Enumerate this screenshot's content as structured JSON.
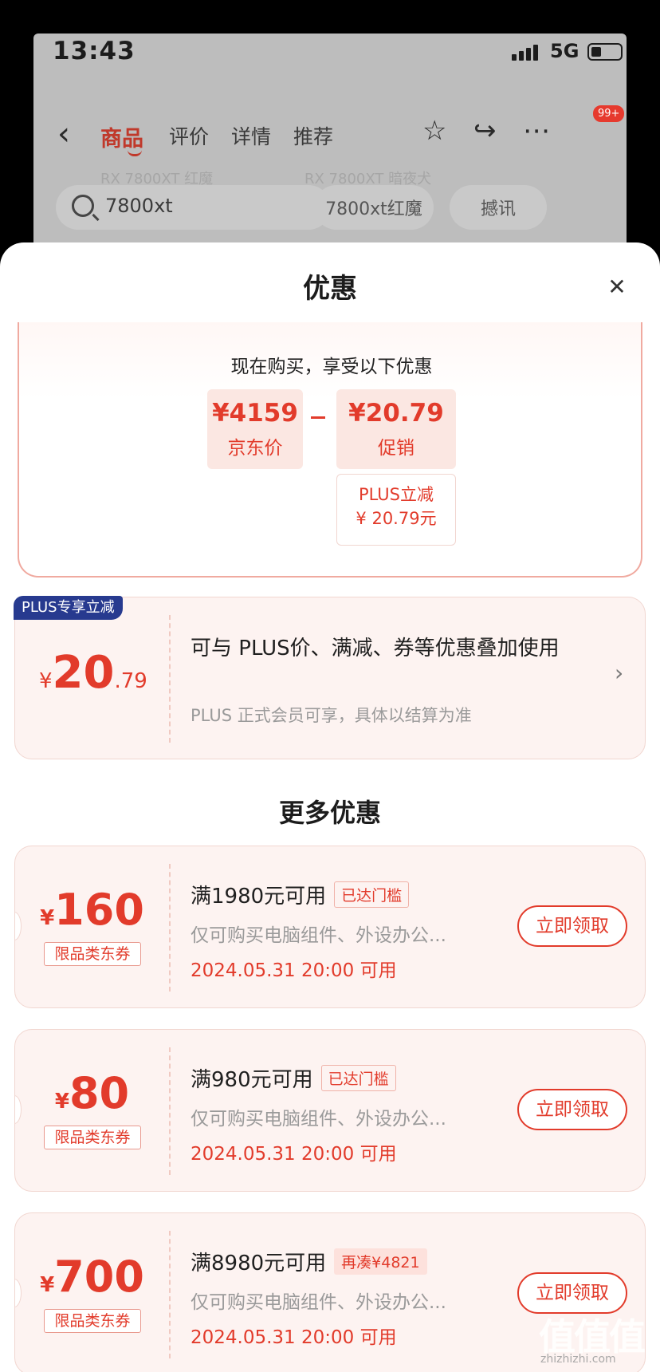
{
  "status_bar": {
    "time": "13:43",
    "network": "5G"
  },
  "nav": {
    "tabs": [
      "商品",
      "评价",
      "详情",
      "推荐"
    ],
    "badge": "99+"
  },
  "background": {
    "ghost_left": "RX 7800XT 红魔",
    "ghost_right": "RX 7800XT 暗夜犬",
    "search_text": "7800xt",
    "chips": [
      "7800xt红魔",
      "撼讯"
    ]
  },
  "sheet": {
    "title": "优惠",
    "summary": {
      "heading": "现在购买，享受以下优惠",
      "jd_price": {
        "amount": "¥4159",
        "label": "京东价"
      },
      "promo": {
        "amount": "¥20.79",
        "label": "促销"
      },
      "plus_line1": "PLUS立减",
      "plus_line2": "¥ 20.79元"
    },
    "plus_card": {
      "tag": "PLUS专享立减",
      "yen": "¥",
      "amount_int": "20",
      "amount_dec": ".79",
      "main": "可与 PLUS价、满减、券等优惠叠加使用",
      "sub": "PLUS 正式会员可享，具体以结算为准"
    },
    "more_title": "更多优惠",
    "coupons": [
      {
        "yen": "¥",
        "amount": "160",
        "type": "限品类东券",
        "threshold": "满1980元可用",
        "status": "已达门槛",
        "desc": "仅可购买电脑组件、外设办公...",
        "date": "2024.05.31 20:00 可用",
        "button": "立即领取"
      },
      {
        "yen": "¥",
        "amount": "80",
        "type": "限品类东券",
        "threshold": "满980元可用",
        "status": "已达门槛",
        "desc": "仅可购买电脑组件、外设办公...",
        "date": "2024.05.31 20:00 可用",
        "button": "立即领取"
      },
      {
        "yen": "¥",
        "amount": "700",
        "type": "限品类东券",
        "threshold": "满8980元可用",
        "status": "再凑¥4821",
        "desc": "仅可购买电脑组件、外设办公...",
        "date": "2024.05.31 20:00 可用",
        "button": "立即领取"
      }
    ]
  },
  "watermark": {
    "main": "值值值",
    "sub": "zhizhizhi.com"
  },
  "colors": {
    "accent": "#e23b2b",
    "plus_blue": "#273a8f",
    "card_bg": "#fdf3f1"
  }
}
